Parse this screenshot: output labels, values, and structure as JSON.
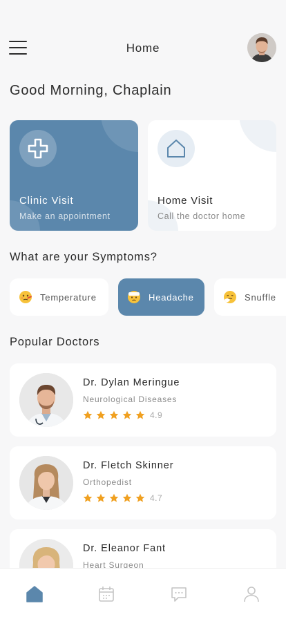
{
  "header": {
    "title": "Home",
    "menu_icon": "hamburger-menu-icon",
    "avatar_icon": "user-avatar"
  },
  "greeting": "Good Morning, Chaplain",
  "visits": [
    {
      "title": "Clinic Visit",
      "subtitle": "Make an appointment",
      "icon": "plus-cross-icon"
    },
    {
      "title": "Home Visit",
      "subtitle": "Call the doctor home",
      "icon": "house-icon"
    }
  ],
  "symptoms": {
    "title": "What are your Symptoms?",
    "items": [
      {
        "label": "Temperature",
        "icon": "thermometer-face-icon",
        "active": false
      },
      {
        "label": "Headache",
        "icon": "headache-face-icon",
        "active": true
      },
      {
        "label": "Snuffle",
        "icon": "sneezing-face-icon",
        "active": false
      }
    ]
  },
  "doctors": {
    "title": "Popular Doctors",
    "items": [
      {
        "name": "Dr. Dylan Meringue",
        "specialty": "Neurological Diseases",
        "rating": "4.9"
      },
      {
        "name": "Dr. Fletch Skinner",
        "specialty": "Orthopedist",
        "rating": "4.7"
      },
      {
        "name": "Dr. Eleanor Fant",
        "specialty": "Heart Surgeon",
        "rating": ""
      }
    ]
  },
  "tabbar": {
    "items": [
      "home-icon",
      "calendar-icon",
      "chat-icon",
      "profile-icon"
    ],
    "active": "home-icon"
  },
  "colors": {
    "accent": "#5b87ac",
    "star": "#f0a020",
    "background": "#f7f7f8"
  }
}
